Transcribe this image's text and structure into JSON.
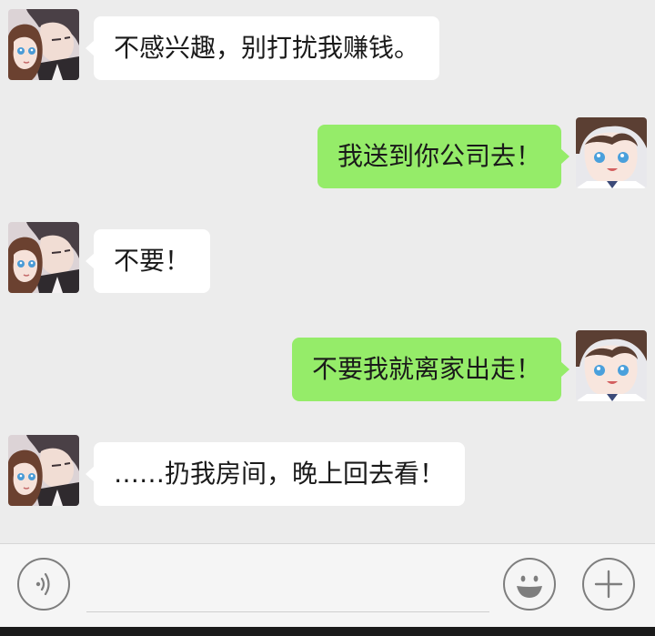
{
  "messages": [
    {
      "side": "in",
      "avatar": "couple-avatar",
      "text": "不感兴趣，别打扰我赚钱。"
    },
    {
      "side": "out",
      "avatar": "boy-avatar",
      "text": "我送到你公司去！"
    },
    {
      "side": "in",
      "avatar": "couple-avatar",
      "text": "不要！"
    },
    {
      "side": "out",
      "avatar": "boy-avatar",
      "text": "不要我就离家出走！"
    },
    {
      "side": "in",
      "avatar": "couple-avatar",
      "text": "……扔我房间，晚上回去看！"
    }
  ],
  "input_bar": {
    "voice_icon": "voice-icon",
    "emoji_icon": "emoji-icon",
    "plus_icon": "plus-icon",
    "input_value": "",
    "input_placeholder": ""
  },
  "colors": {
    "background": "#ececec",
    "incoming_bubble": "#ffffff",
    "outgoing_bubble": "#95ec69",
    "icon_stroke": "#7e7e7e"
  }
}
